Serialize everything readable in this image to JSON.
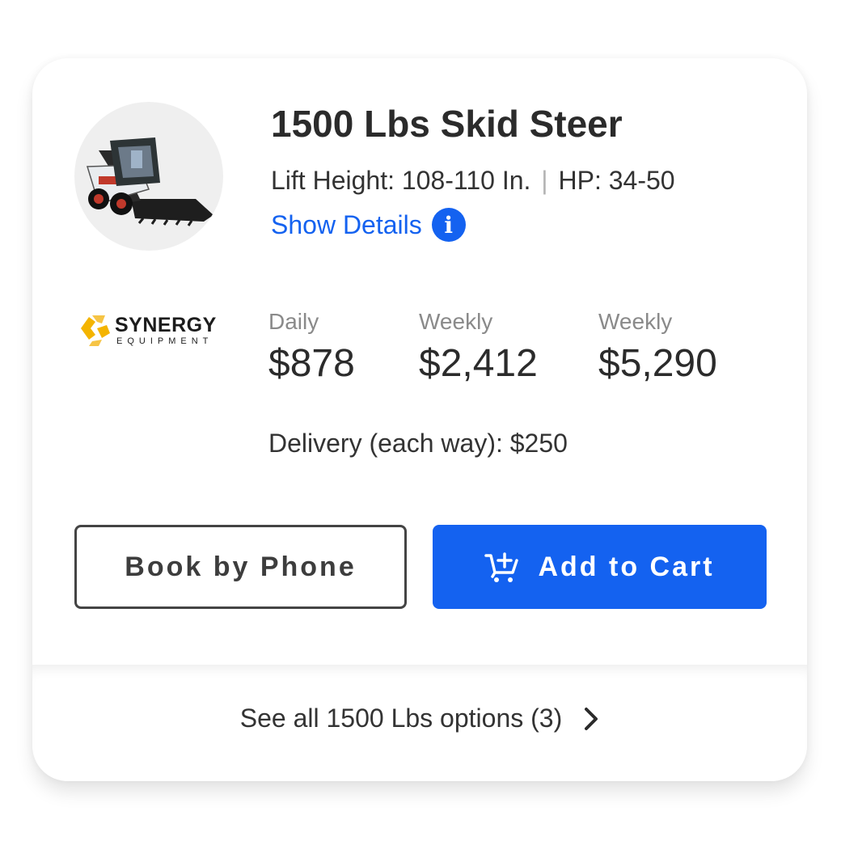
{
  "product": {
    "title": "1500 Lbs Skid Steer",
    "lift_height": "Lift Height: 108-110 In.",
    "separator": "|",
    "hp": "HP: 34-50",
    "show_details_label": "Show Details",
    "info_icon_glyph": "i"
  },
  "vendor": {
    "logo_name": "SYNERGY",
    "logo_sub": "EQUIPMENT",
    "logo_color": "#f4b400"
  },
  "pricing": [
    {
      "label": "Daily",
      "amount": "$878"
    },
    {
      "label": "Weekly",
      "amount": "$2,412"
    },
    {
      "label": "Weekly",
      "amount": "$5,290"
    }
  ],
  "delivery": "Delivery (each way): $250",
  "buttons": {
    "book_by_phone": "Book by Phone",
    "add_to_cart": "Add to Cart"
  },
  "footer": {
    "see_all": "See all 1500 Lbs options (3)"
  },
  "colors": {
    "accent": "#1462f0",
    "text_dark": "#2b2b2b",
    "text_muted": "#8a8a8a"
  },
  "icons": {
    "info": "info-icon",
    "cart": "cart-plus-icon",
    "chevron": "chevron-right-icon"
  }
}
